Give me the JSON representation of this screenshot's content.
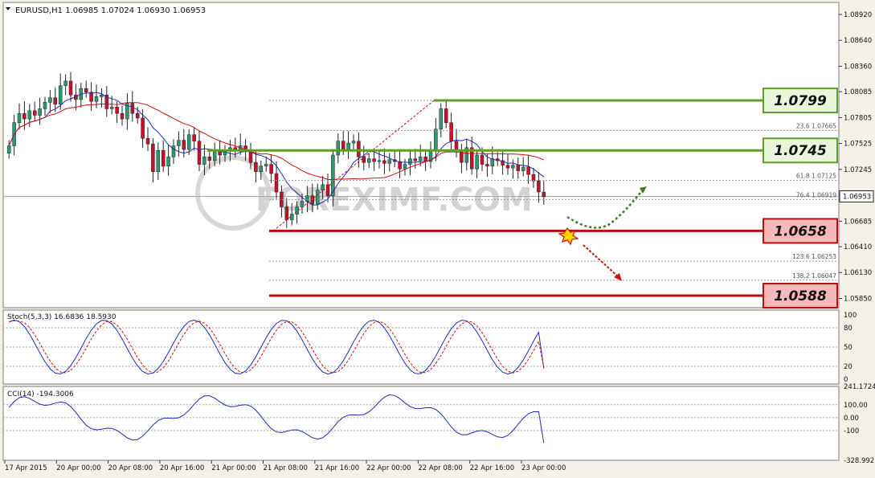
{
  "header": {
    "title": "EURUSD,H1  1.06985 1.07024 1.06930 1.06953"
  },
  "watermark": "FOREXIMF.COM",
  "colors": {
    "bull": "#2a9a72",
    "bear": "#c8102e",
    "ma_fast": "#1f2cb4",
    "ma_slow": "#cc1111",
    "support": "#b50e0e",
    "resistance": "#5f9d2c",
    "grid": "#c8c3b6"
  },
  "chart_data": [
    {
      "type": "candlestick",
      "symbol": "EURUSD",
      "timeframe": "H1",
      "ohlc_header": {
        "open": 1.06985,
        "high": 1.07024,
        "low": 1.0693,
        "close": 1.06953
      },
      "ylim": [
        1.0575,
        1.0905
      ],
      "y_ticks": [
        "1.08920",
        "1.08640",
        "1.08360",
        "1.08085",
        "1.07805",
        "1.07525",
        "1.07245",
        "1.06965",
        "1.06685",
        "1.06410",
        "1.06130",
        "1.05850"
      ],
      "current_price": "1.06953",
      "x_ticks": [
        "17 Apr 2015",
        "20 Apr 00:00",
        "20 Apr 08:00",
        "20 Apr 16:00",
        "21 Apr 00:00",
        "21 Apr 08:00",
        "21 Apr 16:00",
        "22 Apr 00:00",
        "22 Apr 08:00",
        "22 Apr 16:00",
        "23 Apr 00:00"
      ],
      "candles_close": [
        1.075,
        1.0775,
        1.0785,
        1.0779,
        1.0788,
        1.0783,
        1.079,
        1.0797,
        1.0802,
        1.0795,
        1.0815,
        1.082,
        1.0805,
        1.08,
        1.0812,
        1.0808,
        1.0798,
        1.0803,
        1.0805,
        1.079,
        1.0792,
        1.0785,
        1.0779,
        1.0796,
        1.0785,
        1.078,
        1.0758,
        1.0752,
        1.0722,
        1.0745,
        1.0728,
        1.0738,
        1.075,
        1.0756,
        1.0746,
        1.0762,
        1.0755,
        1.073,
        1.0738,
        1.0734,
        1.0744,
        1.074,
        1.0745,
        1.0748,
        1.0746,
        1.075,
        1.0744,
        1.0732,
        1.0722,
        1.0728,
        1.073,
        1.072,
        1.07,
        1.0684,
        1.067,
        1.0676,
        1.0684,
        1.069,
        1.0696,
        1.0687,
        1.0702,
        1.0708,
        1.0696,
        1.074,
        1.0755,
        1.0746,
        1.0753,
        1.0755,
        1.0738,
        1.0732,
        1.0736,
        1.0733,
        1.0734,
        1.0731,
        1.0735,
        1.0733,
        1.0725,
        1.073,
        1.0736,
        1.0734,
        1.0738,
        1.0733,
        1.0745,
        1.0768,
        1.079,
        1.0775,
        1.0755,
        1.0745,
        1.0732,
        1.0748,
        1.0725,
        1.074,
        1.073,
        1.0728,
        1.0736,
        1.0734,
        1.0729,
        1.0726,
        1.0729,
        1.0723,
        1.0727,
        1.0719,
        1.0712,
        1.07,
        1.0695
      ],
      "ma_fast": {
        "color": "#1f2cb4",
        "period_visible": false
      },
      "ma_slow": {
        "color": "#cc1111",
        "period_visible": false
      },
      "fibonacci": [
        {
          "label": "23.6",
          "value": "1.07665"
        },
        {
          "label": "61.8",
          "value": "1.07125"
        },
        {
          "label": "76.4",
          "value": "1.06919"
        },
        {
          "label": "123.6",
          "value": "1.06253"
        },
        {
          "label": "138.2",
          "value": "1.06047"
        }
      ],
      "levels": [
        {
          "kind": "resistance",
          "value": "1.0799"
        },
        {
          "kind": "resistance",
          "value": "1.0745"
        },
        {
          "kind": "support",
          "value": "1.0658"
        },
        {
          "kind": "support",
          "value": "1.0588"
        }
      ]
    },
    {
      "type": "line",
      "indicator": "Stoch(5,3,3)",
      "label": "Stoch(5,3,3) 16.6836 18.5930",
      "main": 16.6836,
      "signal": 18.593,
      "ylim": [
        0,
        100
      ],
      "y_ticks": [
        "100",
        "80",
        "50",
        "20",
        "0"
      ]
    },
    {
      "type": "line",
      "indicator": "CCI(14)",
      "label": "CCI(14) -194.3006",
      "value": -194.3006,
      "ylim": [
        -328.9921,
        241.1724
      ],
      "y_ticks": [
        "241.1724",
        "100.00",
        "0.00",
        "-100",
        "-328.9921"
      ]
    }
  ]
}
